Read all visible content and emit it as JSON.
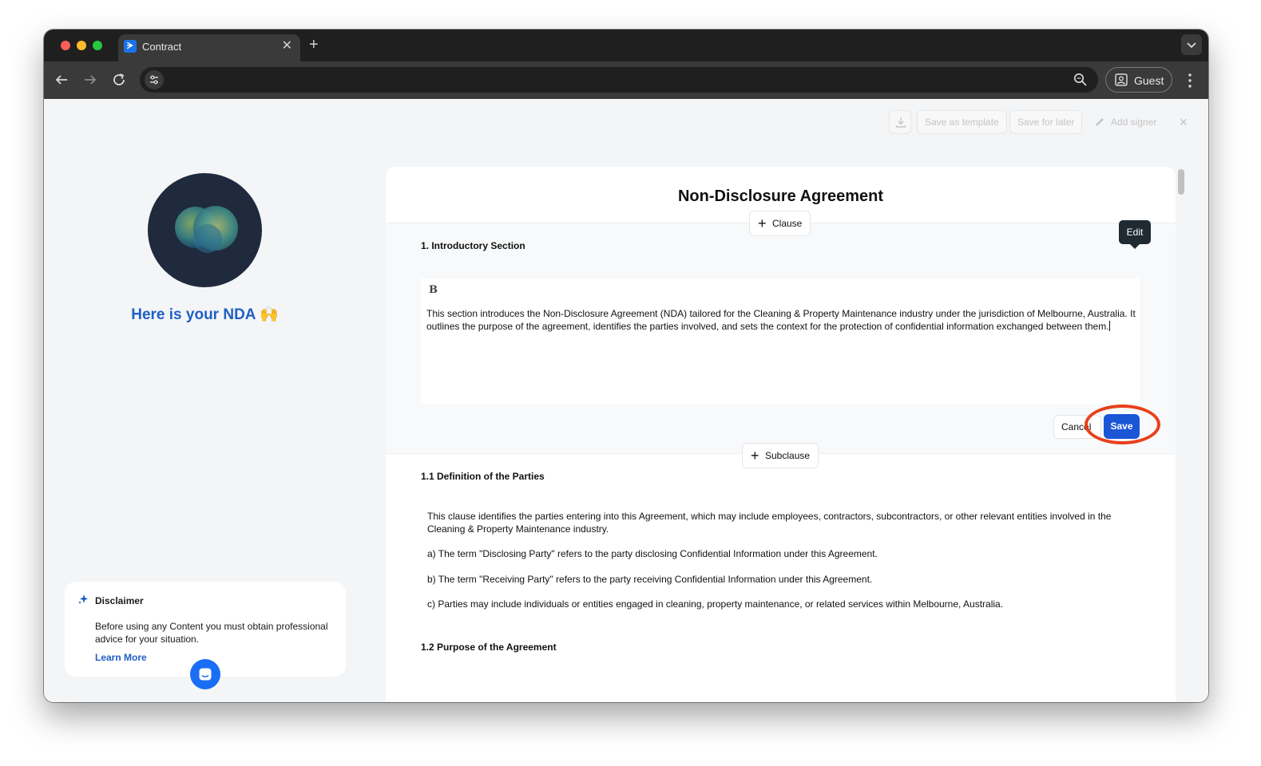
{
  "browser": {
    "tab_title": "Contract",
    "tab_favicon_glyph": "ᗒ",
    "new_tab_glyph": "+",
    "close_glyph": "✕",
    "url": "",
    "profile_label": "Guest"
  },
  "toolbar_actions": {
    "save_template": "Save as template",
    "save_later": "Save for later",
    "add_signer": "Add signer",
    "close_glyph": "✕"
  },
  "left_panel": {
    "headline": "Here is your NDA 🙌",
    "disclaimer_title": "Disclaimer",
    "disclaimer_body": "Before using any Content you must obtain professional advice for your situation.",
    "learn_more": "Learn More"
  },
  "document": {
    "title": "Non-Disclosure Agreement",
    "add_clause_label": "Clause",
    "section1_heading": "1. Introductory Section",
    "editor_bold_label": "B",
    "section1_text": "This section introduces the Non-Disclosure Agreement (NDA) tailored for the Cleaning & Property Maintenance industry under the jurisdiction of Melbourne, Australia. It outlines the purpose of the agreement, identifies the parties involved, and sets the context for the protection of confidential information exchanged between them.",
    "tooltip_edit": "Edit",
    "cancel_label": "Cancel",
    "save_label": "Save",
    "add_subclause_label": "Subclause",
    "sub1_heading": "1.1 Definition of the Parties",
    "sub1_para1": "This clause identifies the parties entering into this Agreement, which may include employees, contractors, subcontractors, or other relevant entities involved in the Cleaning & Property Maintenance industry.",
    "sub1_para2": "a) The term \"Disclosing Party\" refers to the party disclosing Confidential Information under this Agreement.",
    "sub1_para3": "b) The term \"Receiving Party\" refers to the party receiving Confidential Information under this Agreement.",
    "sub1_para4": "c) Parties may include individuals or entities engaged in cleaning, property maintenance, or related services within Melbourne, Australia.",
    "sub2_heading": "1.2 Purpose of the Agreement"
  },
  "colors": {
    "accent": "#1a56d6",
    "headline": "#1f5fc6",
    "annotation": "#e8401c"
  }
}
